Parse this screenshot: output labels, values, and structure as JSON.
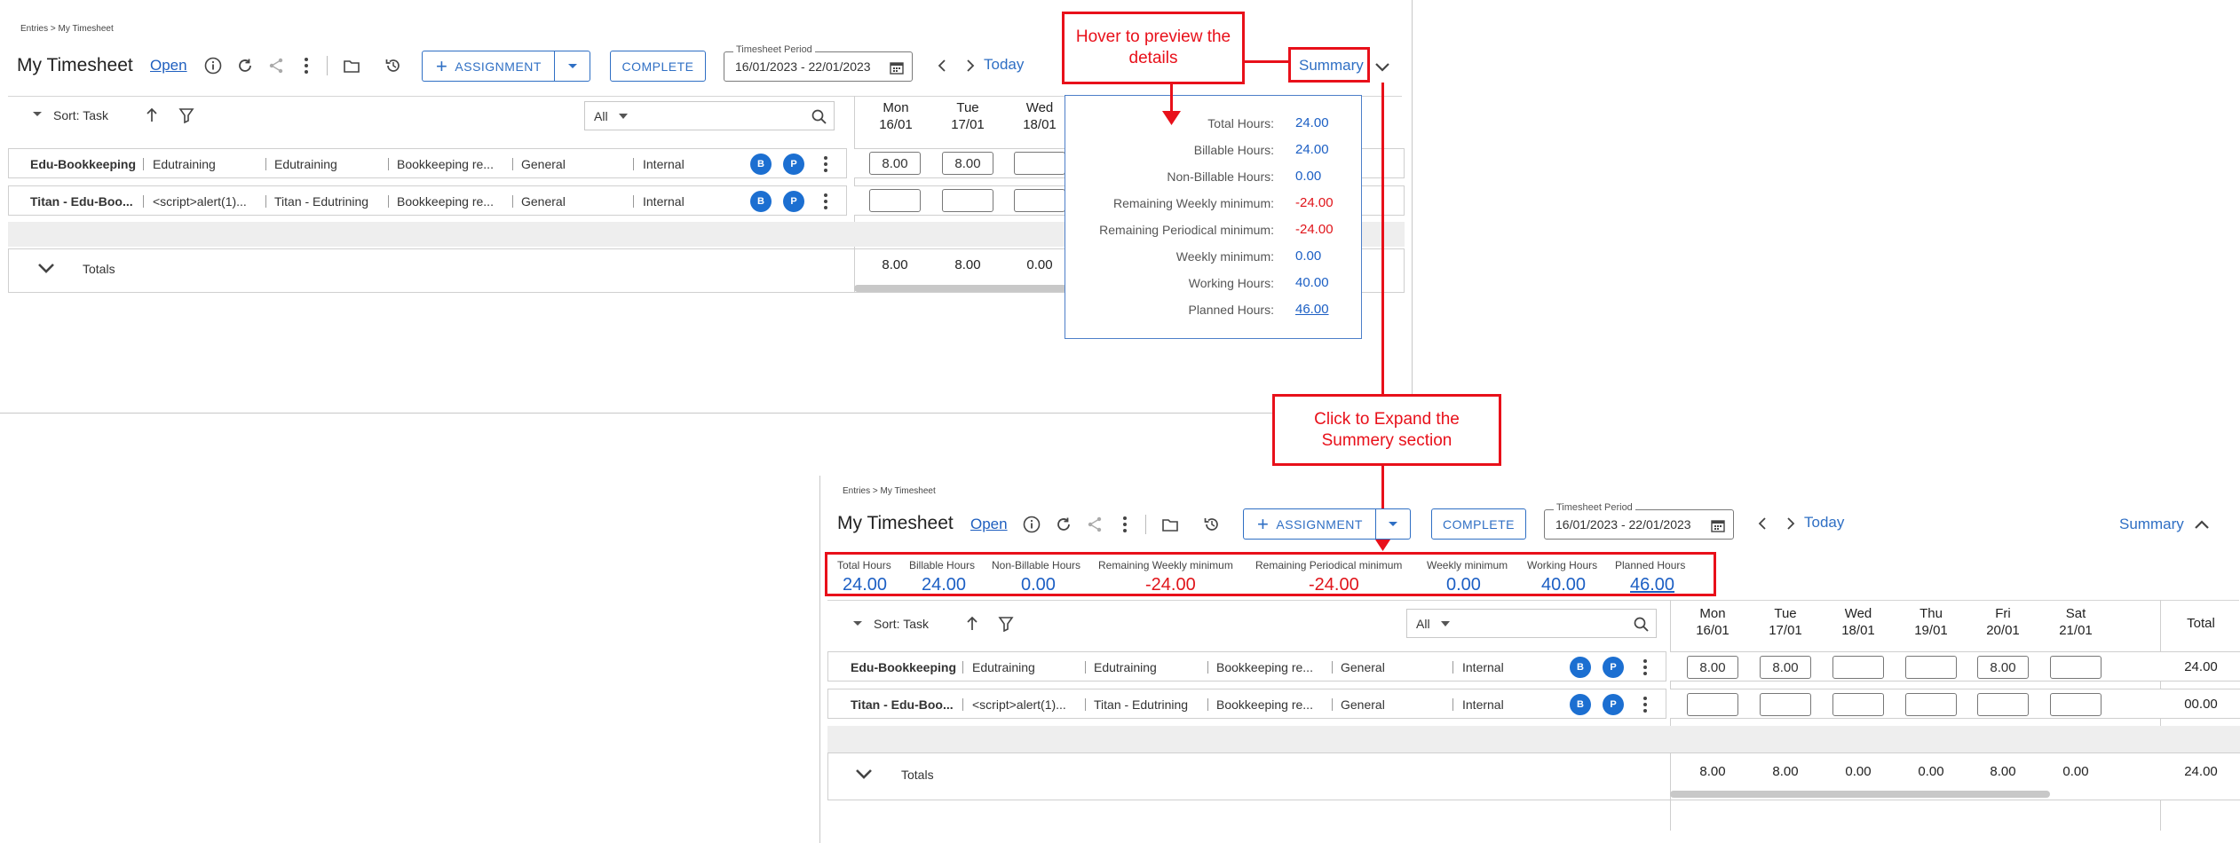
{
  "top": {
    "breadcrumb": "Entries > My Timesheet",
    "title": "My Timesheet",
    "status": "Open",
    "assignment_label": "ASSIGNMENT",
    "complete_label": "COMPLETE",
    "period_label": "Timesheet Period",
    "period_value": "16/01/2023 - 22/01/2023",
    "today_label": "Today",
    "summary_label": "Summary",
    "sort_label": "Sort: Task",
    "filter_value": "All",
    "days": [
      {
        "name": "Mon",
        "date": "16/01"
      },
      {
        "name": "Tue",
        "date": "17/01"
      },
      {
        "name": "Wed",
        "date": "18/01"
      }
    ],
    "rows": [
      {
        "task": "Edu-Bookkeeping",
        "c1": "Edutraining",
        "c2": "Edutraining",
        "c3": "Bookkeeping re...",
        "c4": "General",
        "c5": "Internal",
        "b1": "B",
        "b2": "P",
        "entries": [
          "8.00",
          "8.00",
          ""
        ]
      },
      {
        "task": "Titan - Edu-Boo...",
        "c1": "<script>alert(1)...",
        "c2": "Titan - Edutrining",
        "c3": "Bookkeeping re...",
        "c4": "General",
        "c5": "Internal",
        "b1": "B",
        "b2": "P",
        "entries": [
          "",
          "",
          ""
        ]
      }
    ],
    "totals_label": "Totals",
    "totals": [
      "8.00",
      "8.00",
      "0.00"
    ]
  },
  "popup": {
    "items": [
      {
        "label": "Total Hours:",
        "value": "24.00"
      },
      {
        "label": "Billable Hours:",
        "value": "24.00"
      },
      {
        "label": "Non-Billable Hours:",
        "value": "0.00"
      },
      {
        "label": "Remaining Weekly minimum:",
        "value": "-24.00"
      },
      {
        "label": "Remaining Periodical minimum:",
        "value": "-24.00"
      },
      {
        "label": "Weekly minimum:",
        "value": "0.00"
      },
      {
        "label": "Working Hours:",
        "value": "40.00"
      },
      {
        "label": "Planned Hours:",
        "value": "46.00"
      }
    ]
  },
  "callouts": {
    "hover": "Hover to preview the details",
    "click": "Click to Expand the Summery section"
  },
  "bottom": {
    "breadcrumb": "Entries > My Timesheet",
    "title": "My Timesheet",
    "status": "Open",
    "assignment_label": "ASSIGNMENT",
    "complete_label": "COMPLETE",
    "period_label": "Timesheet Period",
    "period_value": "16/01/2023 - 22/01/2023",
    "today_label": "Today",
    "summary_label": "Summary",
    "sort_label": "Sort: Task",
    "filter_value": "All",
    "summary": [
      {
        "label": "Total Hours",
        "value": "24.00"
      },
      {
        "label": "Billable Hours",
        "value": "24.00"
      },
      {
        "label": "Non-Billable Hours",
        "value": "0.00"
      },
      {
        "label": "Remaining Weekly minimum",
        "value": "-24.00"
      },
      {
        "label": "Remaining Periodical minimum",
        "value": "-24.00"
      },
      {
        "label": "Weekly minimum",
        "value": "0.00"
      },
      {
        "label": "Working Hours",
        "value": "40.00"
      },
      {
        "label": "Planned Hours",
        "value": "46.00"
      }
    ],
    "days": [
      {
        "name": "Mon",
        "date": "16/01"
      },
      {
        "name": "Tue",
        "date": "17/01"
      },
      {
        "name": "Wed",
        "date": "18/01"
      },
      {
        "name": "Thu",
        "date": "19/01"
      },
      {
        "name": "Fri",
        "date": "20/01"
      },
      {
        "name": "Sat",
        "date": "21/01"
      }
    ],
    "total_header": "Total",
    "rows": [
      {
        "task": "Edu-Bookkeeping",
        "c1": "Edutraining",
        "c2": "Edutraining",
        "c3": "Bookkeeping re...",
        "c4": "General",
        "c5": "Internal",
        "b1": "B",
        "b2": "P",
        "entries": [
          "8.00",
          "8.00",
          "",
          "",
          "8.00",
          ""
        ],
        "total": "24.00"
      },
      {
        "task": "Titan - Edu-Boo...",
        "c1": "<script>alert(1)...",
        "c2": "Titan - Edutrining",
        "c3": "Bookkeeping re...",
        "c4": "General",
        "c5": "Internal",
        "b1": "B",
        "b2": "P",
        "entries": [
          "",
          "",
          "",
          "",
          "",
          ""
        ],
        "total": "00.00"
      }
    ],
    "totals_label": "Totals",
    "totals": [
      "8.00",
      "8.00",
      "0.00",
      "0.00",
      "8.00",
      "0.00"
    ],
    "grand_total": "24.00"
  }
}
